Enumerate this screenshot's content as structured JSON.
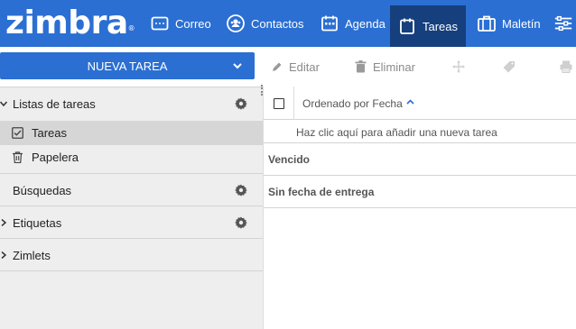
{
  "app": {
    "logo_text": "zimbra",
    "logo_mark": "®"
  },
  "nav": {
    "tabs": [
      {
        "label": "Correo",
        "icon": "mail-icon"
      },
      {
        "label": "Contactos",
        "icon": "contacts-icon"
      },
      {
        "label": "Agenda",
        "icon": "calendar-icon"
      },
      {
        "label": "Tareas",
        "icon": "tasks-icon",
        "active": true
      },
      {
        "label": "Maletín",
        "icon": "briefcase-icon"
      }
    ]
  },
  "toolbar": {
    "new_label": "NUEVA TAREA",
    "edit_label": "Editar",
    "delete_label": "Eliminar"
  },
  "sidebar": {
    "task_lists_header": "Listas de tareas",
    "items": [
      {
        "label": "Tareas",
        "icon": "checkbox-icon",
        "selected": true
      },
      {
        "label": "Papelera",
        "icon": "trash-icon"
      }
    ],
    "searches_header": "Búsquedas",
    "tags_header": "Etiquetas",
    "zimlets_header": "Zimlets"
  },
  "list": {
    "sort_label": "Ordenado por Fecha",
    "add_hint": "Haz clic aquí para añadir una nueva tarea",
    "groups": [
      "Vencido",
      "Sin fecha de entrega"
    ]
  },
  "colors": {
    "brand_blue": "#2b6fd3",
    "active_tab": "#163f7e",
    "sidebar_bg": "#eeeeee"
  }
}
